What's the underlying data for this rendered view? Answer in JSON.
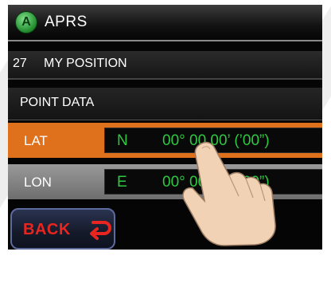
{
  "header": {
    "title": "APRS",
    "logo_letter": "A",
    "logo_icon": "aprs-logo-icon"
  },
  "menu": {
    "number": "27",
    "label": "MY POSITION"
  },
  "section": {
    "label": "POINT DATA"
  },
  "coordinates": {
    "lat": {
      "label": "LAT",
      "hemisphere": "N",
      "value": "00° 00.00’ (’00”)",
      "selected": true
    },
    "lon": {
      "label": "LON",
      "hemisphere": "E",
      "value": "00° 00.00’ (’00”)",
      "selected": false
    }
  },
  "back_button": {
    "label": "BACK",
    "icon": "return-arrow-icon"
  },
  "colors": {
    "highlight": "#e0711c",
    "value_text": "#2fc842",
    "back_text": "#e8251f",
    "screen_bg": "#050505"
  },
  "overlay": {
    "icon": "pointing-hand-icon"
  }
}
